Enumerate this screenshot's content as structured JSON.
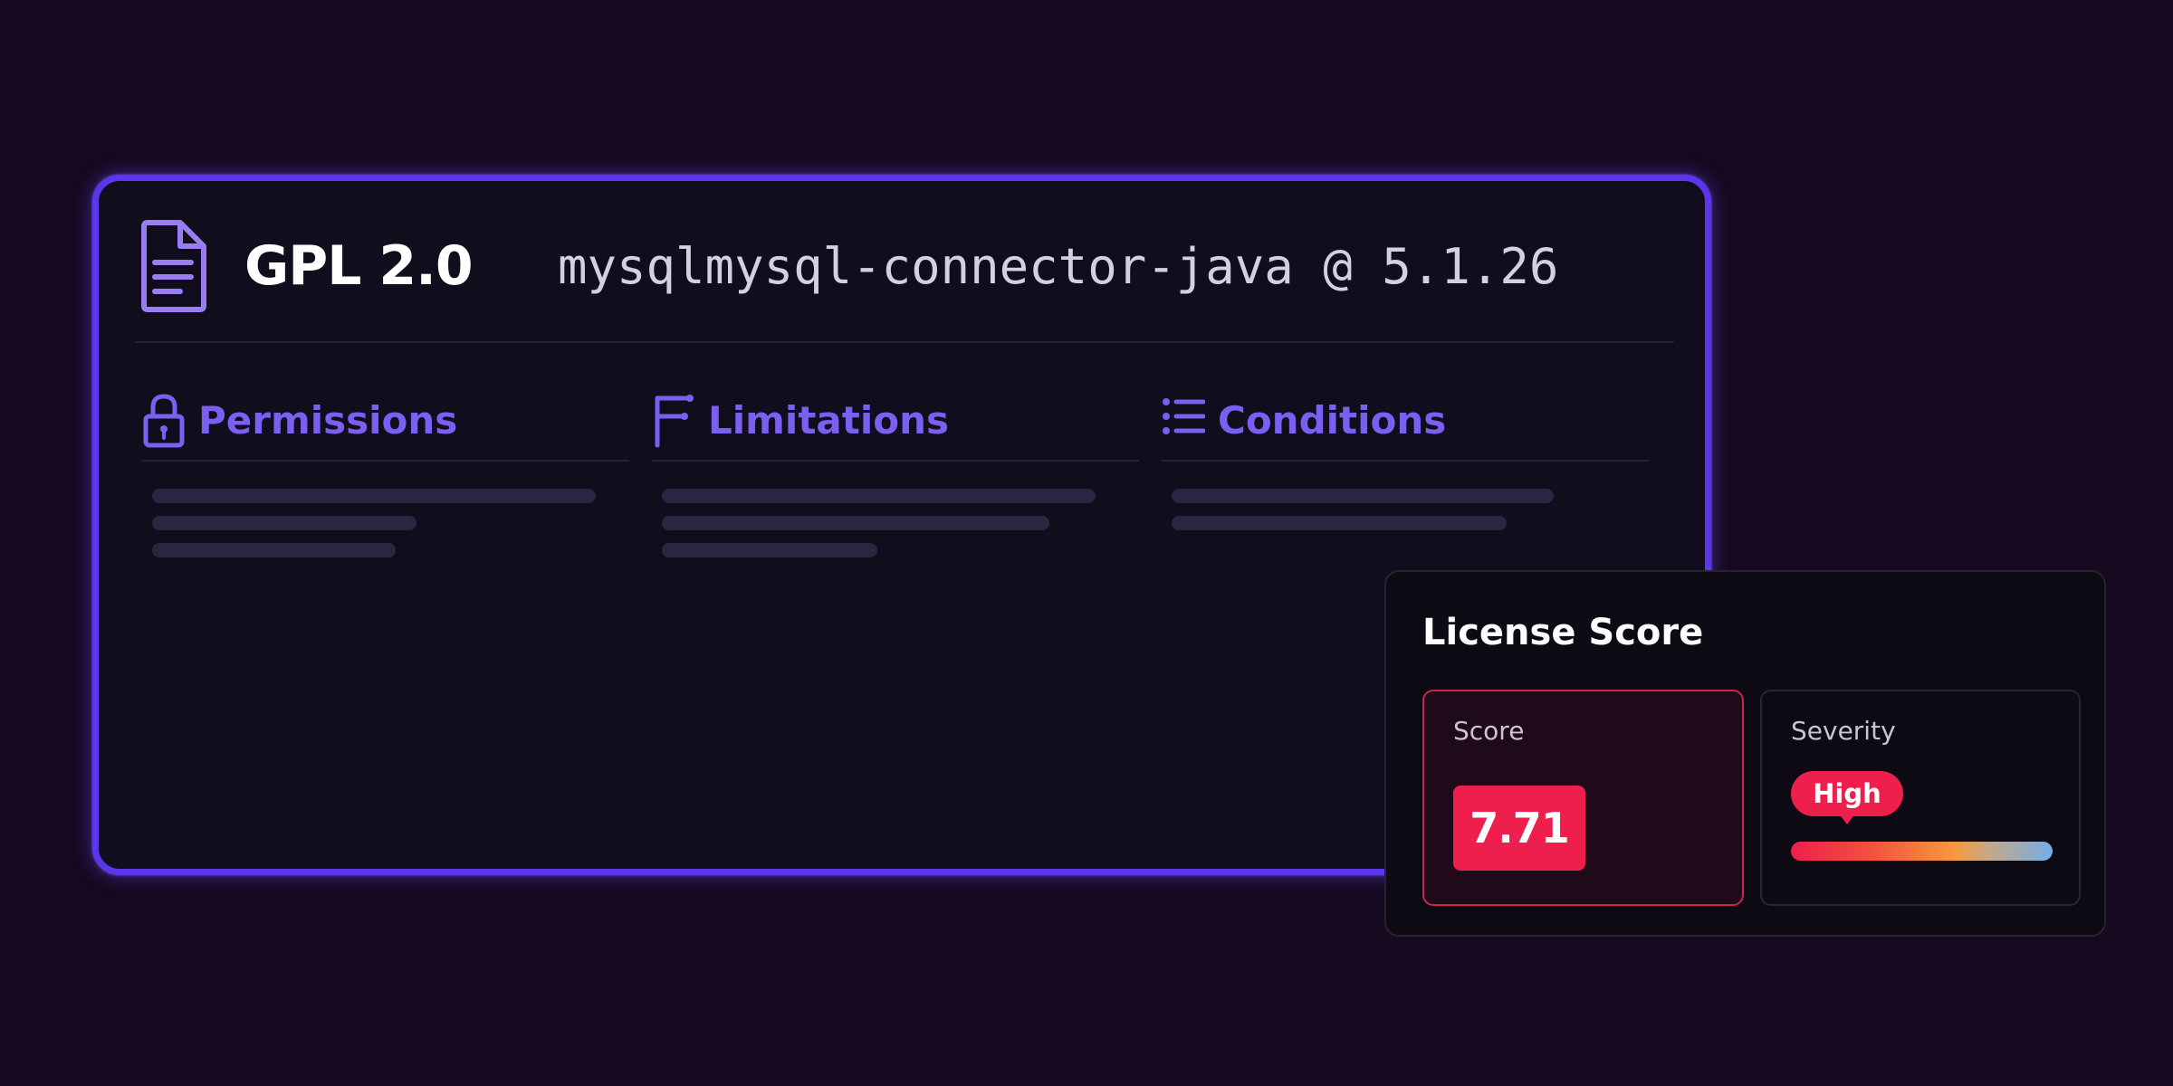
{
  "license": {
    "name": "GPL 2.0",
    "package": "mysqlmysql-connector-java @ 5.1.26",
    "icon": "document-icon"
  },
  "sections": [
    {
      "title": "Permissions",
      "icon": "lock-icon"
    },
    {
      "title": "Limitations",
      "icon": "limitations-icon"
    },
    {
      "title": "Conditions",
      "icon": "list-icon"
    }
  ],
  "score_panel": {
    "title": "License Score",
    "score_label": "Score",
    "score_value": "7.71",
    "severity_label": "Severity",
    "severity_value": "High"
  },
  "colors": {
    "accent": "#5b36ec",
    "section_title": "#7b5ff0",
    "danger": "#ee1f4d",
    "background": "#150a20",
    "card": "#100d1c"
  }
}
